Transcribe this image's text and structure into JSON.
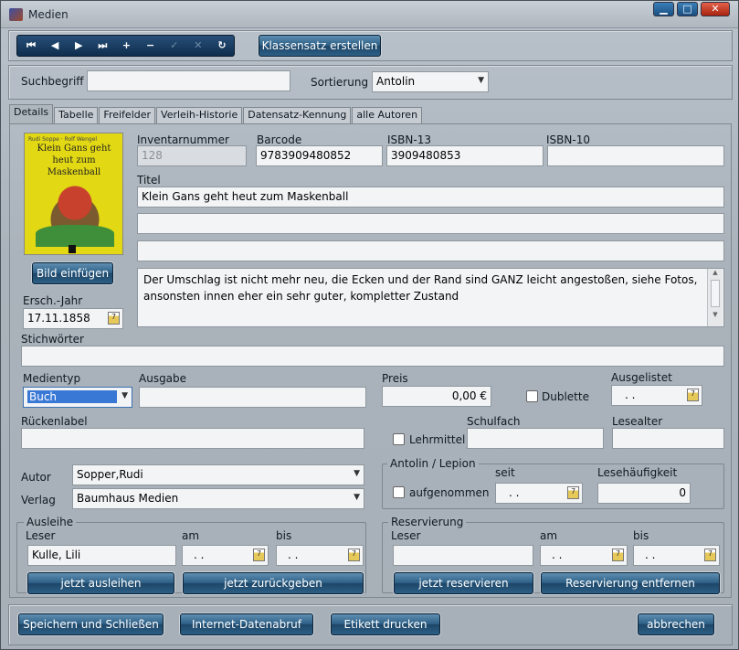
{
  "window": {
    "title": "Medien"
  },
  "toolbar": {
    "nav": [
      "⏮",
      "◀",
      "▶",
      "⏭",
      "+",
      "−",
      "✓",
      "✕",
      "↻"
    ],
    "klassensatz_label": "Klassensatz erstellen"
  },
  "search": {
    "label": "Suchbegriff",
    "value": "",
    "sort_label": "Sortierung",
    "sort_value": "Antolin"
  },
  "tabs": [
    "Details",
    "Tabelle",
    "Freifelder",
    "Verleih-Historie",
    "Datensatz-Kennung",
    "alle Autoren"
  ],
  "cover": {
    "author_line": "Rudi Soppe · Rolf Wengel",
    "title": "Klein Gans geht heut zum Maskenball"
  },
  "image_button": "Bild einfügen",
  "fields": {
    "inventar_label": "Inventarnummer",
    "inventar_value": "128",
    "barcode_label": "Barcode",
    "barcode_value": "9783909480852",
    "isbn13_label": "ISBN-13",
    "isbn13_value": "3909480853",
    "isbn10_label": "ISBN-10",
    "isbn10_value": "",
    "titel_label": "Titel",
    "titel_value": "Klein Gans geht heut zum Maskenball",
    "titel2_value": "",
    "titel3_value": "",
    "note": "Der Umschlag ist nicht mehr neu, die Ecken und der Rand sind GANZ leicht angestoßen, siehe Fotos, ansonsten innen eher ein sehr guter, kompletter Zustand",
    "jahr_label": "Ersch.-Jahr",
    "jahr_value": "17.11.1858",
    "stich_label": "Stichwörter",
    "stich_value": "",
    "medientyp_label": "Medientyp",
    "medientyp_value": "Buch",
    "ausgabe_label": "Ausgabe",
    "ausgabe_value": "",
    "preis_label": "Preis",
    "preis_value": "0,00 €",
    "dublette_label": "Dublette",
    "ausgelistet_label": "Ausgelistet",
    "ausgelistet_value": ". .",
    "ruecken_label": "Rückenlabel",
    "ruecken_value": "",
    "lehrmittel_label": "Lehrmittel",
    "schulfach_label": "Schulfach",
    "schulfach_value": "",
    "lesealter_label": "Lesealter",
    "lesealter_value": "",
    "autor_label": "Autor",
    "autor_value": "Sopper,Rudi",
    "verlag_label": "Verlag",
    "verlag_value": "Baumhaus Medien"
  },
  "antolin": {
    "title": "Antolin / Lepion",
    "seit_label": "seit",
    "seit_value": ". .",
    "aufgenommen_label": "aufgenommen",
    "haeufigkeit_label": "Lesehäufigkeit",
    "haeufigkeit_value": "0"
  },
  "ausleihe": {
    "title": "Ausleihe",
    "leser_label": "Leser",
    "leser_value": "Kulle, Lili",
    "am_label": "am",
    "am_value": ". .",
    "bis_label": "bis",
    "bis_value": ". .",
    "btn_ausleihen": "jetzt ausleihen",
    "btn_zurueck": "jetzt zurückgeben"
  },
  "reservierung": {
    "title": "Reservierung",
    "leser_label": "Leser",
    "leser_value": "",
    "am_label": "am",
    "am_value": ". .",
    "bis_label": "bis",
    "bis_value": ". .",
    "btn_reservieren": "jetzt reservieren",
    "btn_entfernen": "Reservierung entfernen"
  },
  "footer": {
    "save": "Speichern und Schließen",
    "internet": "Internet-Datenabruf",
    "etikett": "Etikett drucken",
    "cancel": "abbrechen"
  }
}
